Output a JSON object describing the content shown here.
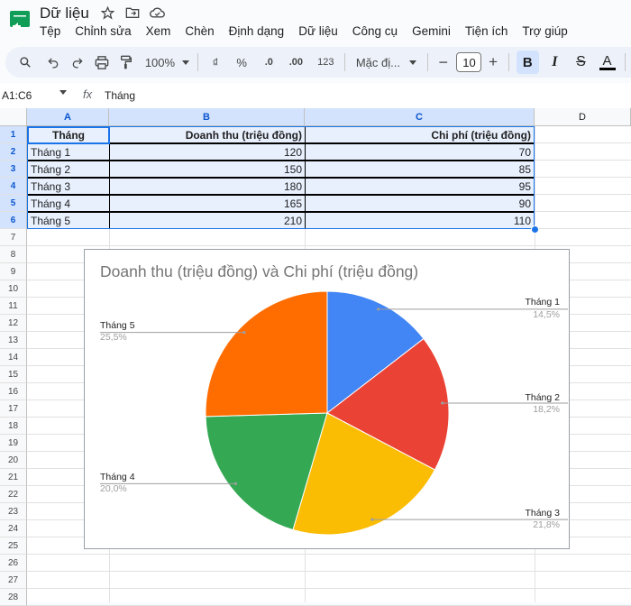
{
  "app": {
    "title": "Dữ liệu"
  },
  "menu": [
    "Tệp",
    "Chỉnh sửa",
    "Xem",
    "Chèn",
    "Định dạng",
    "Dữ liệu",
    "Công cụ",
    "Gemini",
    "Tiện ích",
    "Trợ giúp"
  ],
  "toolbar": {
    "zoom": "100%",
    "currency": "₫",
    "percent": "%",
    "dec_decrease": ".0",
    "dec_increase": ".00",
    "format_123": "123",
    "font": "Mặc đị...",
    "font_size": "10",
    "bold": "B",
    "italic": "I",
    "strike": "S",
    "text_color": "A"
  },
  "formula_bar": {
    "name_box": "A1:C6",
    "fx": "fx",
    "value": "Tháng"
  },
  "columns": [
    "A",
    "B",
    "C",
    "D"
  ],
  "rows": [
    "1",
    "2",
    "3",
    "4",
    "5",
    "6",
    "7",
    "8",
    "9",
    "10",
    "11",
    "12",
    "13",
    "14",
    "15",
    "16",
    "17",
    "18",
    "19",
    "20",
    "21",
    "22",
    "23",
    "24",
    "25",
    "26",
    "27",
    "28"
  ],
  "table": {
    "headers": [
      "Tháng",
      "Doanh thu (triệu đồng)",
      "Chi phí (triệu đồng)"
    ],
    "rows": [
      [
        "Tháng 1",
        "120",
        "70"
      ],
      [
        "Tháng 2",
        "150",
        "85"
      ],
      [
        "Tháng 3",
        "180",
        "95"
      ],
      [
        "Tháng 4",
        "165",
        "90"
      ],
      [
        "Tháng 5",
        "210",
        "110"
      ]
    ]
  },
  "chart_data": {
    "type": "pie",
    "title": "Doanh thu (triệu đồng) và Chi phí (triệu đồng)",
    "categories": [
      "Tháng 1",
      "Tháng 2",
      "Tháng 3",
      "Tháng 4",
      "Tháng 5"
    ],
    "values": [
      120,
      150,
      180,
      165,
      210
    ],
    "percent_labels": [
      "14,5%",
      "18,2%",
      "21,8%",
      "20,0%",
      "25,5%"
    ],
    "colors": [
      "#4285f4",
      "#ea4335",
      "#fbbc04",
      "#34a853",
      "#ff6d01"
    ],
    "legend": "labels with leader lines"
  }
}
